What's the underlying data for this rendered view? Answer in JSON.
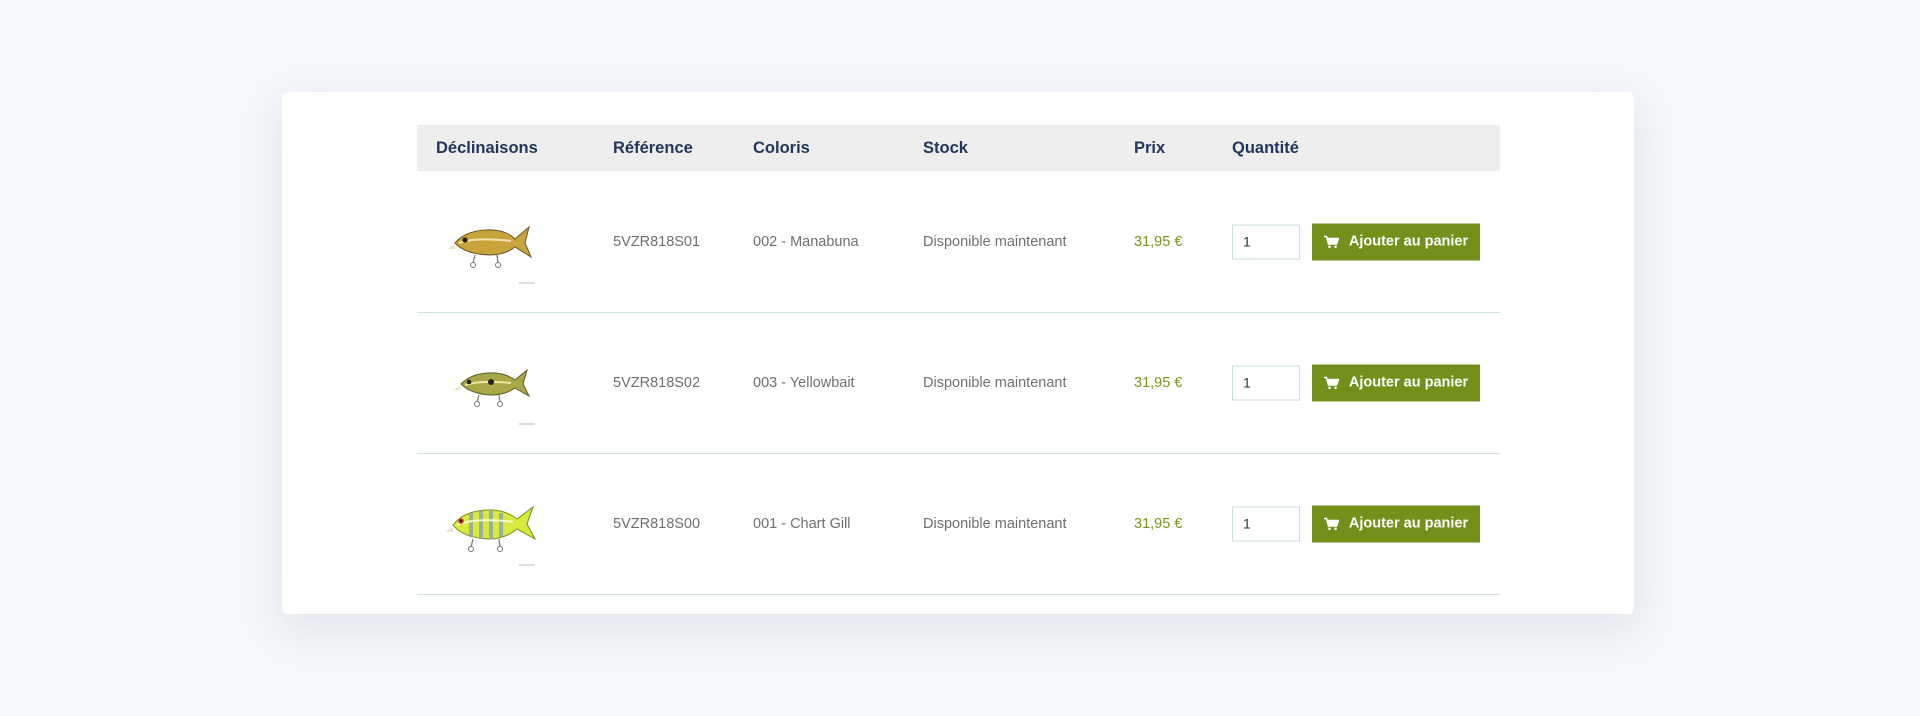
{
  "table": {
    "headers": {
      "variants": "Déclinaisons",
      "reference": "Référence",
      "color": "Coloris",
      "stock": "Stock",
      "price": "Prix",
      "quantity": "Quantité"
    },
    "rows": [
      {
        "image": "lure-manabuna-icon",
        "reference": "5VZR818S01",
        "color": "002 - Manabuna",
        "stock": "Disponible maintenant",
        "price": "31,95 €",
        "quantity": "1",
        "add_label": "Ajouter au panier"
      },
      {
        "image": "lure-yellowbait-icon",
        "reference": "5VZR818S02",
        "color": "003 - Yellowbait",
        "stock": "Disponible maintenant",
        "price": "31,95 €",
        "quantity": "1",
        "add_label": "Ajouter au panier"
      },
      {
        "image": "lure-chart-gill-icon",
        "reference": "5VZR818S00",
        "color": "001 - Chart Gill",
        "stock": "Disponible maintenant",
        "price": "31,95 €",
        "quantity": "1",
        "add_label": "Ajouter au panier"
      }
    ]
  },
  "colors": {
    "header_text": "#22365c",
    "price": "#7a9518",
    "button": "#72901a",
    "row_border": "#cfe3e3"
  }
}
